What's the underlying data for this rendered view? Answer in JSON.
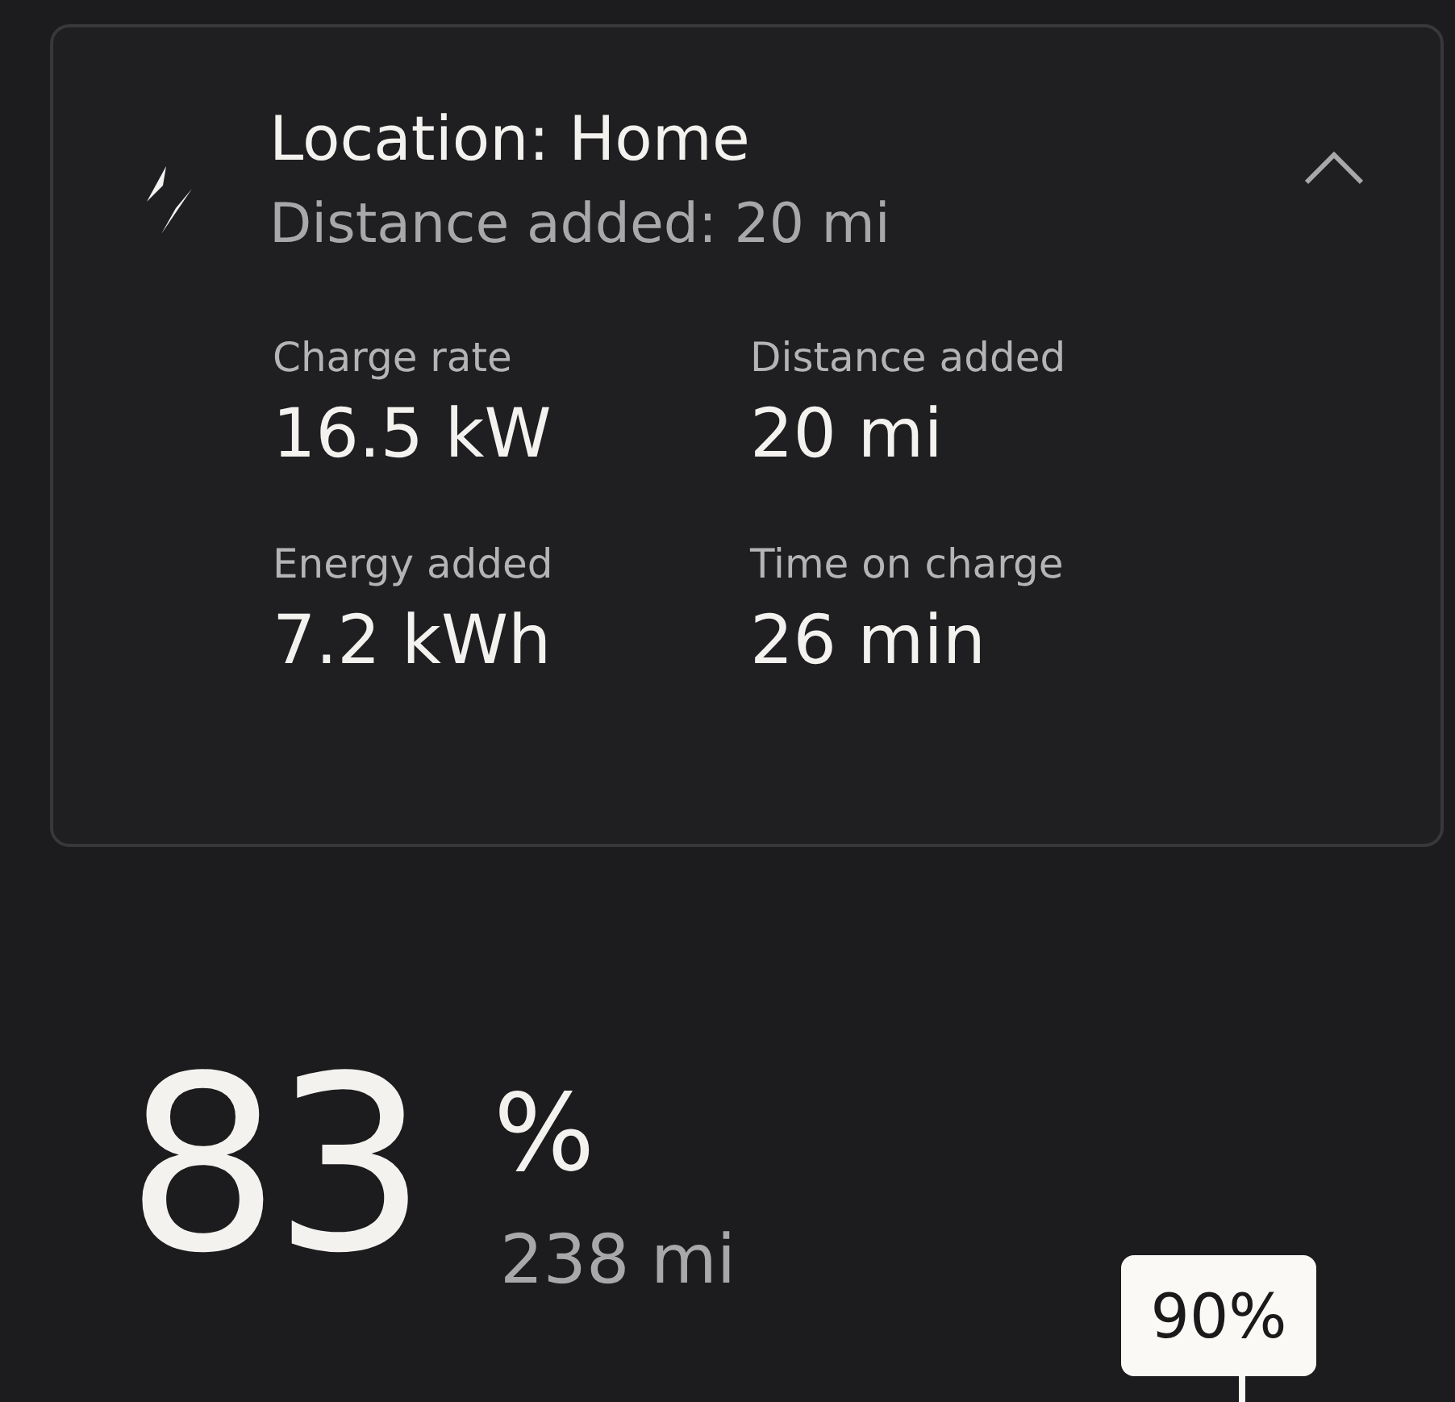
{
  "session": {
    "title": "Location: Home",
    "subtitle": "Distance added: 20 mi",
    "expanded": true,
    "stats": [
      {
        "label": "Charge rate",
        "value": "16.5 kW"
      },
      {
        "label": "Distance added",
        "value": "20 mi"
      },
      {
        "label": "Energy added",
        "value": "7.2 kWh"
      },
      {
        "label": "Time on charge",
        "value": "26 min"
      }
    ]
  },
  "battery": {
    "percent": "83",
    "unit": "%",
    "range": "238 mi",
    "limit_label": "90%"
  }
}
